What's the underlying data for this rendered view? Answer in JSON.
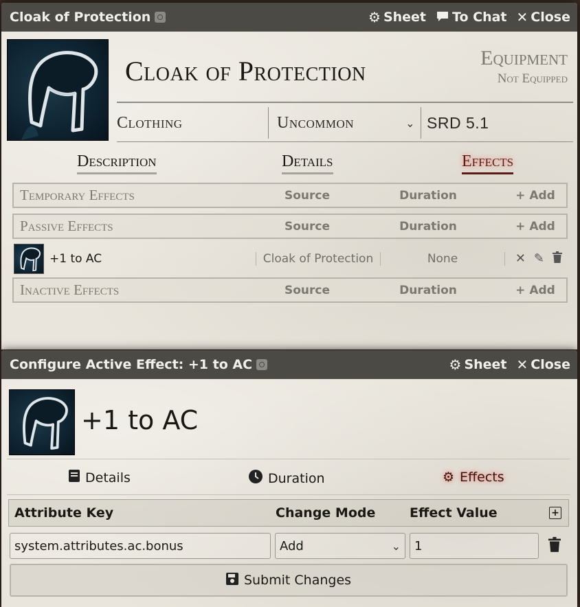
{
  "item_window": {
    "title": "Cloak of Protection",
    "header_buttons": {
      "sheet": "Sheet",
      "to_chat": "To Chat",
      "close": "Close"
    },
    "name": "Cloak of Protection",
    "type_label": "Equipment",
    "equip_status": "Not Equipped",
    "meta": {
      "category": "Clothing",
      "rarity": "Uncommon",
      "source": "SRD 5.1"
    },
    "tabs": [
      {
        "label": "Description",
        "active": false
      },
      {
        "label": "Details",
        "active": false
      },
      {
        "label": "Effects",
        "active": true
      }
    ],
    "effect_sections": {
      "temporary": {
        "name": "Temporary Effects",
        "source": "Source",
        "duration": "Duration",
        "add": "Add"
      },
      "passive": {
        "name": "Passive Effects",
        "source": "Source",
        "duration": "Duration",
        "add": "Add"
      },
      "inactive": {
        "name": "Inactive Effects",
        "source": "Source",
        "duration": "Duration",
        "add": "Add"
      }
    },
    "passive_effect": {
      "name": "+1 to AC",
      "source": "Cloak of Protection",
      "duration": "None"
    }
  },
  "config_window": {
    "title": "Configure Active Effect: +1 to AC",
    "header_buttons": {
      "sheet": "Sheet",
      "close": "Close"
    },
    "name": "+1 to AC",
    "tabs": [
      {
        "label": "Details",
        "icon": "book-icon",
        "active": false
      },
      {
        "label": "Duration",
        "icon": "clock-icon",
        "active": false
      },
      {
        "label": "Effects",
        "icon": "cogs-icon",
        "active": true
      }
    ],
    "changes_header": {
      "key": "Attribute Key",
      "mode": "Change Mode",
      "value": "Effect Value"
    },
    "change": {
      "key": "system.attributes.ac.bonus",
      "mode": "Add",
      "value": "1"
    },
    "submit_label": "Submit Changes"
  },
  "colors": {
    "titlebar": "#4b4a44",
    "active_tab": "#5b1a12",
    "parchment": "#e9e5dc"
  }
}
